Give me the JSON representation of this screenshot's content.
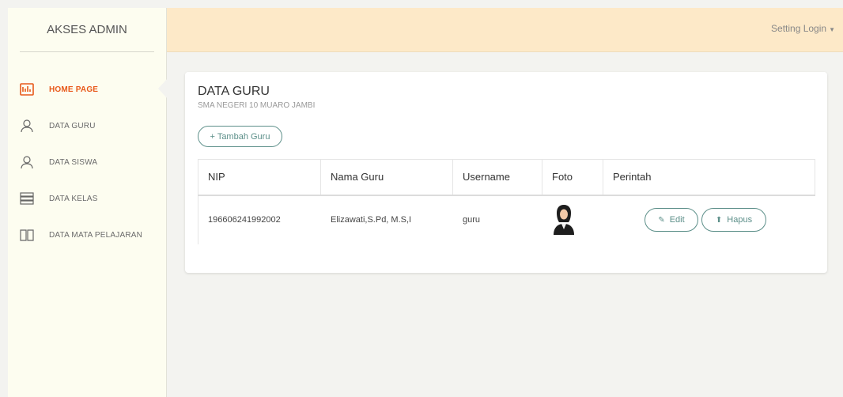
{
  "sidebar": {
    "brand": "AKSES ADMIN",
    "items": [
      {
        "label": "HOME PAGE",
        "icon": "home-icon",
        "active": true
      },
      {
        "label": "DATA GURU",
        "icon": "user-icon"
      },
      {
        "label": "DATA SISWA",
        "icon": "user-icon"
      },
      {
        "label": "DATA KELAS",
        "icon": "server-icon"
      },
      {
        "label": "DATA MATA PELAJARAN",
        "icon": "book-icon"
      }
    ]
  },
  "topbar": {
    "setting_label": "Setting Login"
  },
  "page": {
    "title": "DATA GURU",
    "subtitle": "SMA NEGERI 10 MUARO JAMBI",
    "add_button": "+ Tambah Guru"
  },
  "table": {
    "headers": [
      "NIP",
      "Nama Guru",
      "Username",
      "Foto",
      "Perintah"
    ],
    "rows": [
      {
        "nip": "196606241992002",
        "nama": "Elizawati,S.Pd, M.S,I",
        "username": "guru",
        "edit": "Edit",
        "hapus": "Hapus"
      }
    ]
  },
  "colors": {
    "accent": "#e8591a",
    "topbar": "#fde9c8",
    "sidebar": "#fdfdf0",
    "button": "#5c8f89"
  }
}
